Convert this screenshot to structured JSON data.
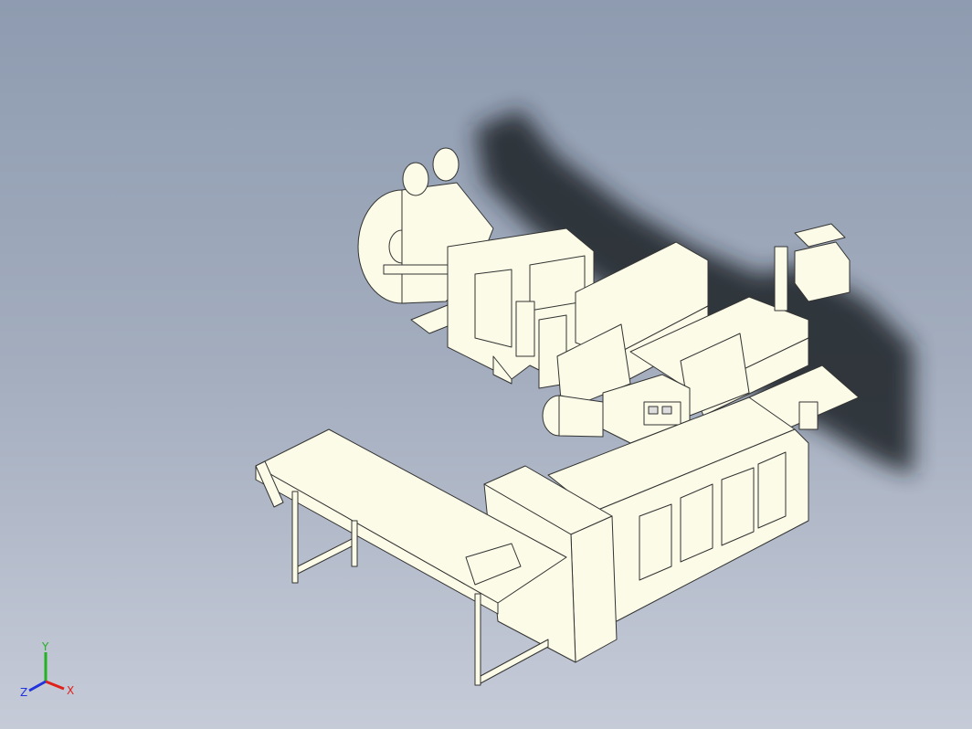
{
  "viewport": {
    "background_top": "#8e9bb0",
    "background_bottom": "#c6cbd8",
    "model_color": "#fbfbe7",
    "edge_color": "#333333",
    "shadow_color": "#1c2026"
  },
  "triad": {
    "x_label": "X",
    "y_label": "Y",
    "z_label": "Z",
    "x_color": "#e0211b",
    "y_color": "#22b222",
    "z_color": "#2233dd"
  }
}
